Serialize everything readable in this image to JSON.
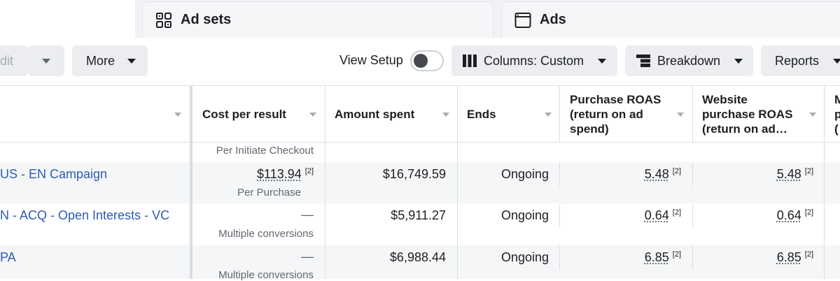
{
  "tabs": {
    "adsets": {
      "label": "Ad sets",
      "icon": "grid-icon"
    },
    "ads": {
      "label": "Ads",
      "icon": "ad-window-icon"
    }
  },
  "toolbar": {
    "edit_label": "dit",
    "more_label": "More",
    "view_setup_label": "View Setup",
    "view_setup_on": false,
    "columns_label": "Columns: Custom",
    "breakdown_label": "Breakdown",
    "reports_label": "Reports"
  },
  "table": {
    "columns": [
      "Cost per result",
      "Amount spent",
      "Ends",
      "Purchase ROAS (return on ad spend)",
      "Website purchase ROAS (return on ad…",
      "M p ("
    ],
    "header_lines": {
      "purchase_roas": [
        "Purchase ROAS",
        "(return on ad",
        "spend)"
      ],
      "website_roas": [
        "Website",
        "purchase ROAS",
        "(return on ad…"
      ],
      "cut_off": [
        "M",
        "p",
        "("
      ]
    },
    "top_partial_sub": "Per Initiate Checkout",
    "rows": [
      {
        "campaign": "US - EN Campaign",
        "cost_per_result": "$113.94",
        "cost_sup": "[2]",
        "cost_sub": "Per Purchase",
        "amount_spent": "$16,749.59",
        "ends": "Ongoing",
        "purchase_roas": "5.48",
        "purchase_roas_sup": "[2]",
        "website_roas": "5.48",
        "website_roas_sup": "[2]"
      },
      {
        "campaign": "N - ACQ - Open Interests - VC",
        "cost_per_result": "—",
        "cost_sub": "Multiple conversions",
        "amount_spent": "$5,911.27",
        "ends": "Ongoing",
        "purchase_roas": "0.64",
        "purchase_roas_sup": "[2]",
        "website_roas": "0.64",
        "website_roas_sup": "[2]"
      },
      {
        "campaign": "PA",
        "cost_per_result": "—",
        "cost_sub": "Multiple conversions",
        "amount_spent": "$6,988.44",
        "ends": "Ongoing",
        "purchase_roas": "6.85",
        "purchase_roas_sup": "[2]",
        "website_roas": "6.85",
        "website_roas_sup": "[2]"
      }
    ]
  }
}
